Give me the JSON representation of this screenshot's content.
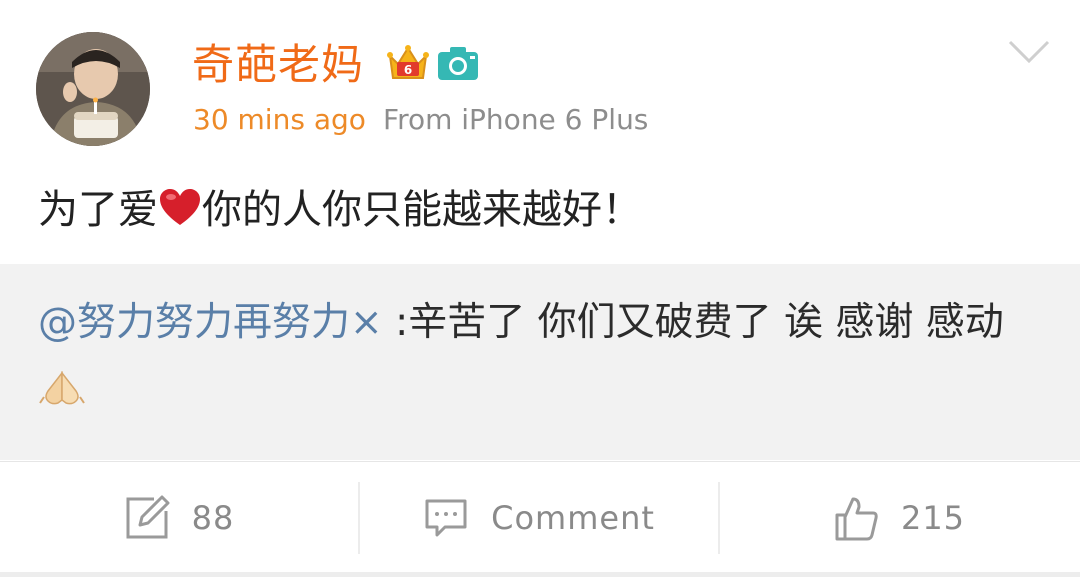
{
  "post": {
    "username": "奇葩老妈",
    "time": "30 mins ago",
    "source": "From iPhone 6 Plus",
    "text_before_emoji": "为了爱",
    "text_after_emoji": "你的人你只能越来越好！",
    "emoji_icon": "heart-icon",
    "badges": [
      "vip-crown-icon",
      "camera-icon"
    ],
    "colors": {
      "username": "#f06a17",
      "time": "#ed8a28",
      "mention": "#5a7fa8",
      "heart": "#d61f2b"
    }
  },
  "retweet": {
    "mention": "@努力努力再努力×",
    "text": " :辛苦了 你们又破费了 诶 感谢 感动",
    "emoji_icon": "pray-hands-icon"
  },
  "actions": {
    "repost_count": "88",
    "comment_label": "Comment",
    "like_count": "215"
  }
}
